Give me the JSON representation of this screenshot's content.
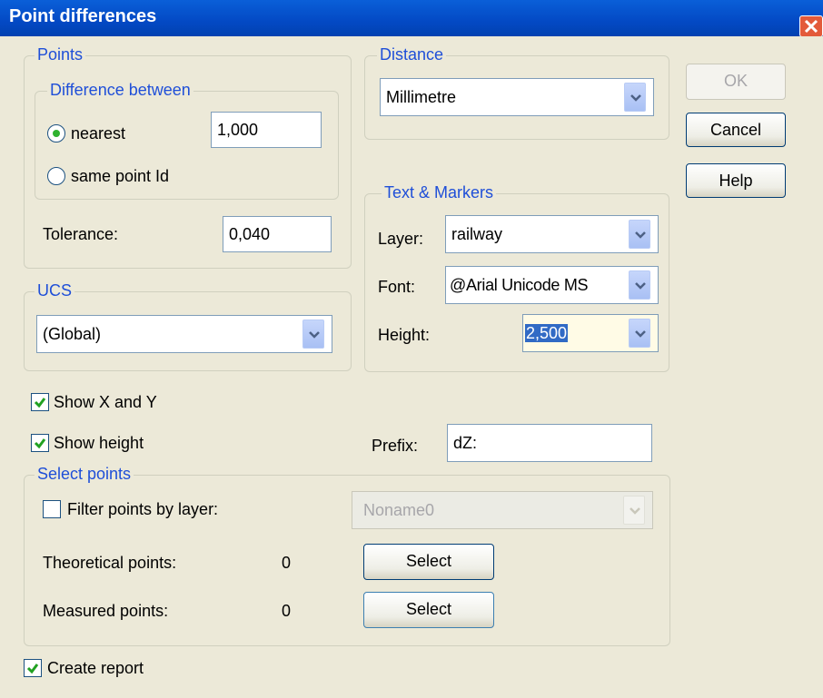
{
  "window": {
    "title": "Point differences"
  },
  "points": {
    "legend": "Points",
    "difference": {
      "legend": "Difference between",
      "nearest_label": "nearest",
      "nearest_value": "1,000",
      "same_label": "same point Id",
      "selected": "nearest"
    },
    "tolerance_label": "Tolerance:",
    "tolerance_value": "0,040"
  },
  "ucs": {
    "legend": "UCS",
    "value": "(Global)"
  },
  "distance": {
    "legend": "Distance",
    "value": "Millimetre"
  },
  "text_markers": {
    "legend": "Text & Markers",
    "layer_label": "Layer:",
    "layer_value": "railway",
    "font_label": "Font:",
    "font_value": "@Arial Unicode MS",
    "height_label": "Height:",
    "height_value": "2,500"
  },
  "buttons": {
    "ok": "OK",
    "cancel": "Cancel",
    "help": "Help"
  },
  "options": {
    "show_xy": {
      "label": "Show X and Y",
      "checked": true
    },
    "show_height": {
      "label": "Show height",
      "checked": true
    },
    "prefix_label": "Prefix:",
    "prefix_value": "dZ:"
  },
  "select_points": {
    "legend": "Select points",
    "filter": {
      "label": "Filter points by layer:",
      "checked": false,
      "layer_value": "Noname0"
    },
    "theoretical": {
      "label": "Theoretical points:",
      "count": "0",
      "button": "Select"
    },
    "measured": {
      "label": "Measured points:",
      "count": "0",
      "button": "Select"
    }
  },
  "create_report": {
    "label": "Create report",
    "checked": true
  },
  "colors": {
    "title_bar": "#0349c4",
    "dialog_bg": "#ece9d8",
    "legend_text": "#1f4fd8",
    "check_mark": "#21a121"
  },
  "icons": {
    "close": "close-icon",
    "dropdown": "chevron-down-icon",
    "check": "check-icon"
  }
}
